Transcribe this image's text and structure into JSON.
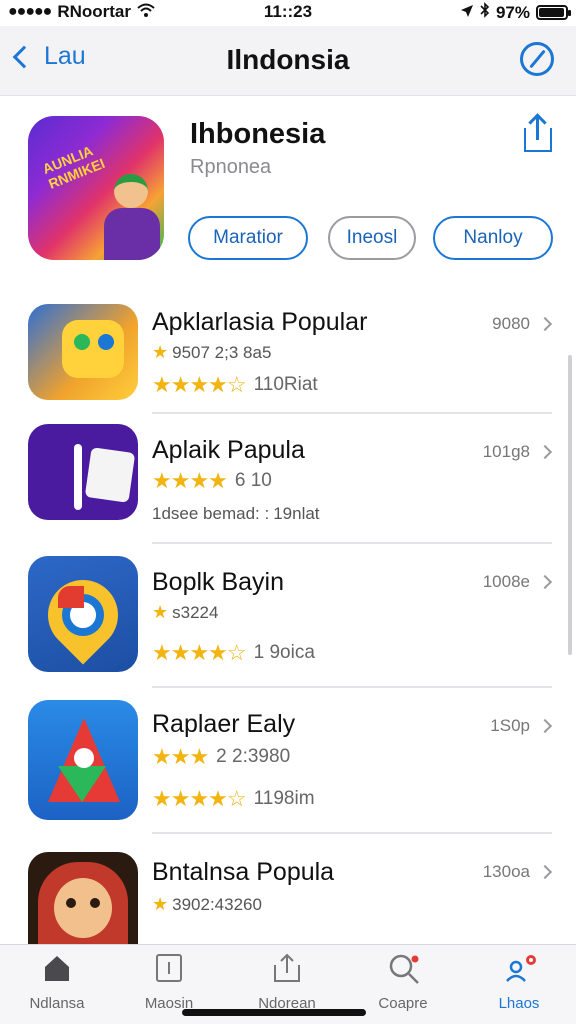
{
  "status_bar": {
    "carrier": "RNoortar",
    "time": "11::23",
    "battery": "97%",
    "battery_level": 0.97
  },
  "nav": {
    "back_label": "Lau",
    "title": "Ilndonsia",
    "back_icon": "chevron-left-icon",
    "right_icon": "compass-icon"
  },
  "header": {
    "icon_text": "AUNLIA RNMIKEI",
    "title": "Ihbonesia",
    "subtitle": "Rpnonea",
    "share_icon": "share-icon",
    "pills": [
      "Maratior",
      "Ineosl",
      "Nanloy"
    ]
  },
  "apps": [
    {
      "title": "Apklarlasia Popular",
      "meta": "9507 2;3 8a5",
      "stars": "★★★★☆",
      "rating_count": "110Riat",
      "size": "9080"
    },
    {
      "title": "Aplaik Papula",
      "meta": "6 10",
      "stars": "★★★★",
      "rating_count": "19nlat",
      "extra": "1dsee bemad: :",
      "size": "101g8"
    },
    {
      "title": "Boplk Bayin",
      "meta": "s3224",
      "stars": "★★★★☆",
      "rating_count": "1 9oica",
      "size": "1008e"
    },
    {
      "title": "Raplaer Ealy",
      "meta": "2 2:3980",
      "stars": "★★★★☆",
      "rating_count": "1198im",
      "size": "1S0p"
    },
    {
      "title": "Bntalnsa Popula",
      "meta": "3902:43260",
      "stars": "",
      "rating_count": "",
      "size": "130oa"
    }
  ],
  "tabs": [
    {
      "label": "Ndlansa",
      "icon": "home-icon"
    },
    {
      "label": "Maosin",
      "icon": "document-icon"
    },
    {
      "label": "Ndorean",
      "icon": "share-tab-icon"
    },
    {
      "label": "Coapre",
      "icon": "search-icon"
    },
    {
      "label": "Lhaos",
      "icon": "people-icon"
    }
  ],
  "colors": {
    "accent": "#1b76d4",
    "star": "#f2b411",
    "nav_bg": "#f3f3f5"
  }
}
